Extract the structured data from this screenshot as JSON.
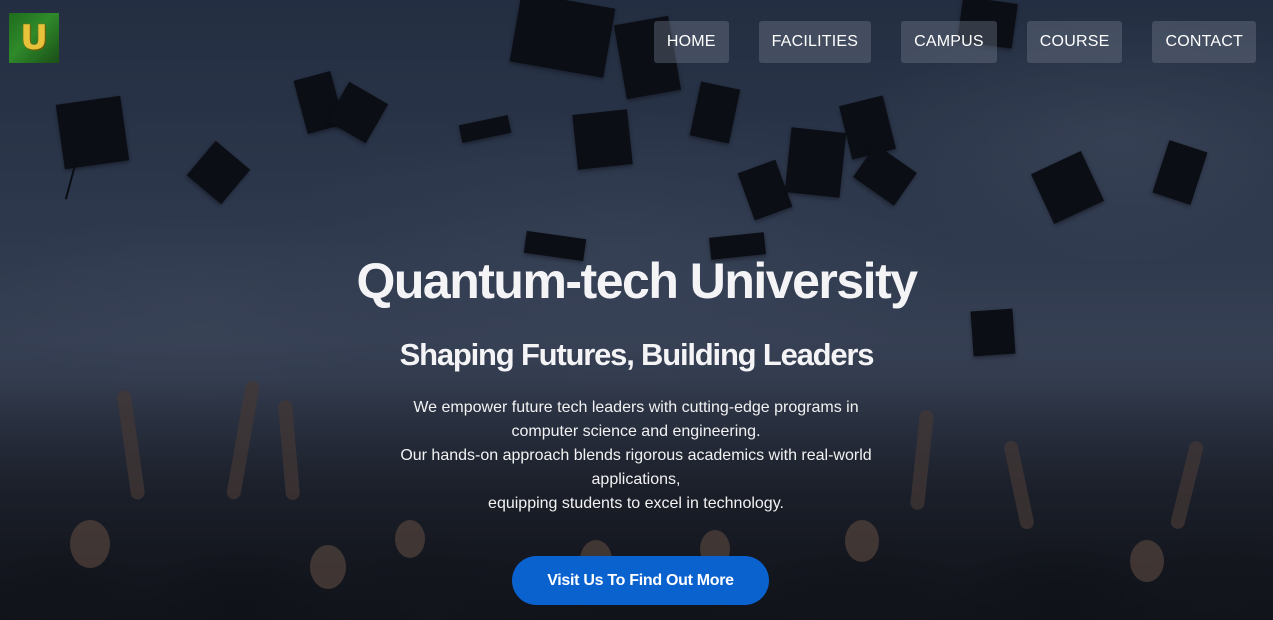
{
  "header": {
    "logo_letter": "U",
    "nav": [
      {
        "label": "HOME"
      },
      {
        "label": "FACILITIES"
      },
      {
        "label": "CAMPUS"
      },
      {
        "label": "COURSE"
      },
      {
        "label": "CONTACT"
      }
    ]
  },
  "hero": {
    "title": "Quantum-tech University",
    "subtitle": "Shaping Futures, Building Leaders",
    "description_lines": [
      "We empower future tech leaders with cutting-edge programs in",
      "computer science and engineering.",
      "Our hands-on approach blends rigorous academics with real-world",
      "applications,",
      "equipping students to excel in technology."
    ],
    "cta_label": "Visit Us To Find Out More"
  },
  "colors": {
    "cta_background": "#0a62cf",
    "logo_green": "#2f8a2a",
    "logo_gold": "#e8c23a",
    "text": "#ffffff"
  }
}
